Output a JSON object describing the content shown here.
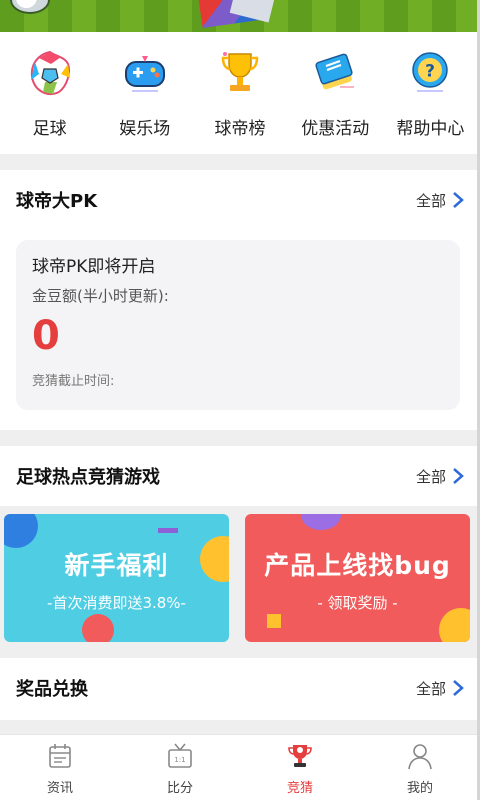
{
  "nav": [
    {
      "label": "足球",
      "icon": "football-icon"
    },
    {
      "label": "娱乐场",
      "icon": "gamepad-icon"
    },
    {
      "label": "球帝榜",
      "icon": "trophy-icon"
    },
    {
      "label": "优惠活动",
      "icon": "ticket-icon"
    },
    {
      "label": "帮助中心",
      "icon": "help-icon"
    }
  ],
  "sections": {
    "pk": {
      "title": "球帝大PK",
      "more": "全部"
    },
    "hot": {
      "title": "足球热点竞猜游戏",
      "more": "全部"
    },
    "prize": {
      "title": "奖品兑换",
      "more": "全部"
    }
  },
  "pk_card": {
    "title": "球帝PK即将开启",
    "subtitle": "金豆额(半小时更新):",
    "amount": "0",
    "deadline": "竞猜截止时间:"
  },
  "promos": [
    {
      "title": "新手福利",
      "subtitle": "-首次消费即送3.8%-"
    },
    {
      "title": "产品上线找bug",
      "subtitle": "- 领取奖励 -"
    }
  ],
  "tabs": [
    {
      "label": "资讯",
      "icon": "calendar-icon",
      "active": false
    },
    {
      "label": "比分",
      "icon": "tv-icon",
      "active": false
    },
    {
      "label": "竞猜",
      "icon": "trophy-cup-icon",
      "active": true
    },
    {
      "label": "我的",
      "icon": "user-icon",
      "active": false
    }
  ],
  "colors": {
    "accent": "#e53e3e",
    "promo_blue": "#4fcde3",
    "promo_red": "#f15b5b",
    "chevron": "#2f6bd6"
  }
}
